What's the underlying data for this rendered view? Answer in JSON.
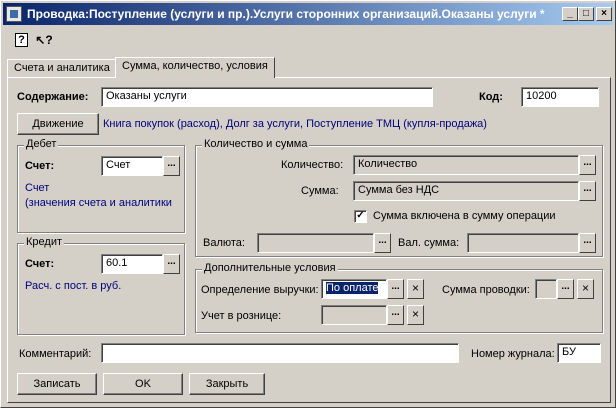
{
  "window": {
    "title": "Проводка:Поступление (услуги и пр.).Услуги сторонних организаций.Оказаны услуги *",
    "minimize": "_",
    "maximize": "□",
    "close": "×"
  },
  "toolbar": {
    "help_icon": "?",
    "context_help_icon": "↖?"
  },
  "tabs": [
    {
      "label": "Счета и аналитика"
    },
    {
      "label": "Сумма, количество, условия"
    }
  ],
  "content": {
    "label": "Содержание:",
    "value": "Оказаны услуги"
  },
  "code": {
    "label": "Код:",
    "value": "10200"
  },
  "movement": {
    "button_label": "Движение",
    "text": "Книга покупок (расход), Долг за услуги, Поступление ТМЦ (купля-продажа)"
  },
  "debit": {
    "title": "Дебет",
    "account_label": "Счет:",
    "account_value": "Счет",
    "desc_line1": "Счет",
    "desc_line2": "(значения счета и аналитики"
  },
  "credit": {
    "title": "Кредит",
    "account_label": "Счет:",
    "account_value": "60.1",
    "desc": "Расч. с пост. в руб."
  },
  "qty_sum": {
    "title": "Количество и сумма",
    "quantity_label": "Количество:",
    "quantity_value": "Количество",
    "sum_label": "Сумма:",
    "sum_value": "Сумма без НДС",
    "included_label": "Сумма включена в сумму операции",
    "included_checked": true,
    "currency_label": "Валюта:",
    "currency_value": "",
    "cur_sum_label": "Вал. сумма:",
    "cur_sum_value": ""
  },
  "extra": {
    "title": "Дополнительные условия",
    "revenue_label": "Определение выручки:",
    "revenue_value": "По оплате",
    "posting_sum_label": "Сумма проводки:",
    "posting_sum_value": "",
    "retail_label": "Учет в рознице:",
    "retail_value": ""
  },
  "comment": {
    "label": "Комментарий:",
    "value": ""
  },
  "journal": {
    "label": "Номер журнала:",
    "value": "БУ"
  },
  "buttons": {
    "save": "Записать",
    "ok": "OK",
    "close": "Закрыть"
  },
  "select_glyph": "...",
  "clear_glyph": "×",
  "check_glyph": "✓"
}
